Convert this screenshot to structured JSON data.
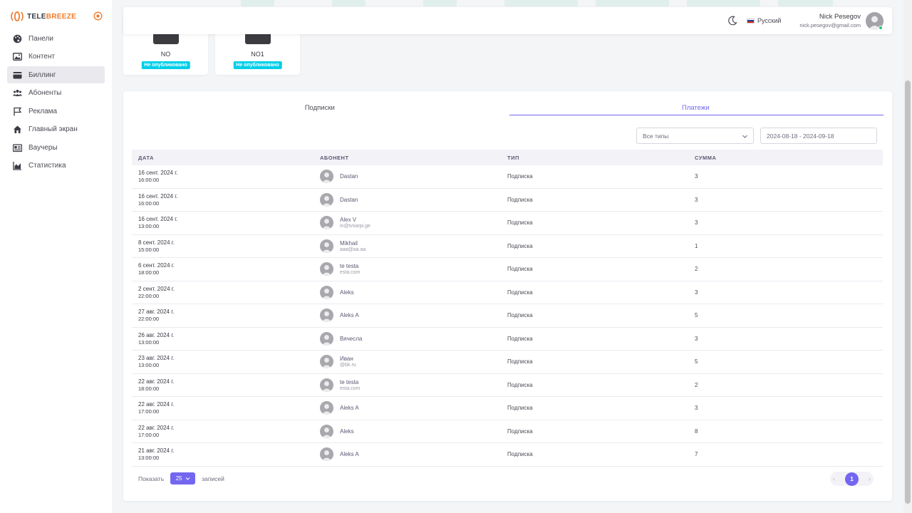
{
  "app": {
    "logo_part1": "TELE",
    "logo_part2": "BREEZE"
  },
  "sidebar": {
    "items": [
      {
        "label": "Панели",
        "icon": "palette-icon"
      },
      {
        "label": "Контент",
        "icon": "image-icon"
      },
      {
        "label": "Биллинг",
        "icon": "wallet-icon"
      },
      {
        "label": "Абоненты",
        "icon": "users-icon"
      },
      {
        "label": "Реклама",
        "icon": "flag-icon"
      },
      {
        "label": "Главный экран",
        "icon": "home-icon"
      },
      {
        "label": "Ваучеры",
        "icon": "voucher-icon"
      },
      {
        "label": "Статистика",
        "icon": "chart-icon"
      }
    ],
    "active_index": 2
  },
  "header": {
    "language": "Русский",
    "user_name": "Nick Pesegov",
    "user_email": "nick.pesegov@gmail.com"
  },
  "cards": [
    {
      "name": "NO",
      "status": "Не опубликовано"
    },
    {
      "name": "NO1",
      "status": "Не опубликовано"
    }
  ],
  "tabs": [
    {
      "label": "Подписки",
      "active": false
    },
    {
      "label": "Платежи",
      "active": true
    }
  ],
  "filters": {
    "type_value": "Все типы",
    "date_range": "2024-08-18 - 2024-09-18"
  },
  "table": {
    "headers": [
      "ДАТА",
      "АБОНЕНТ",
      "ТИП",
      "СУММА"
    ],
    "rows": [
      {
        "date": "16 сент. 2024 г.",
        "time": "16:00:00",
        "name": "Dastan",
        "email": "",
        "type": "Подписка",
        "amount": "3"
      },
      {
        "date": "16 сент. 2024 г.",
        "time": "16:00:00",
        "name": "Dastan",
        "email": "",
        "type": "Подписка",
        "amount": "3"
      },
      {
        "date": "16 сент. 2024 г.",
        "time": "13:00:00",
        "name": "Alex V",
        "email": "in@tvsarpi.ge",
        "type": "Подписка",
        "amount": "3"
      },
      {
        "date": "8 сент. 2024 г.",
        "time": "15:00:00",
        "name": "Mikhail",
        "email": "aaa@aa.aa",
        "type": "Подписка",
        "amount": "1"
      },
      {
        "date": "6 сент. 2024 г.",
        "time": "18:00:00",
        "name": "te testa",
        "email": "esta.com",
        "type": "Подписка",
        "amount": "2"
      },
      {
        "date": "2 сент. 2024 г.",
        "time": "22:00:00",
        "name": "Aleks",
        "email": "",
        "type": "Подписка",
        "amount": "3"
      },
      {
        "date": "27 авг. 2024 г.",
        "time": "22:00:00",
        "name": "Aleks A",
        "email": "",
        "type": "Подписка",
        "amount": "5"
      },
      {
        "date": "26 авг. 2024 г.",
        "time": "13:00:00",
        "name": "Вячесла",
        "email": "",
        "type": "Подписка",
        "amount": "3"
      },
      {
        "date": "23 авг. 2024 г.",
        "time": "13:00:00",
        "name": "Иван",
        "email": "@bk.ru",
        "type": "Подписка",
        "amount": "5"
      },
      {
        "date": "22 авг. 2024 г.",
        "time": "18:00:00",
        "name": "te testa",
        "email": "esta.com",
        "type": "Подписка",
        "amount": "2"
      },
      {
        "date": "22 авг. 2024 г.",
        "time": "17:00:00",
        "name": "Aleks A",
        "email": "",
        "type": "Подписка",
        "amount": "3"
      },
      {
        "date": "22 авг. 2024 г.",
        "time": "17:00:00",
        "name": "Aleks",
        "email": "",
        "type": "Подписка",
        "amount": "8"
      },
      {
        "date": "21 авг. 2024 г.",
        "time": "13:00:00",
        "name": "Aleks A",
        "email": "",
        "type": "Подписка",
        "amount": "7"
      }
    ]
  },
  "footer": {
    "show_label": "Показать",
    "per_page": "25",
    "records_label": "записей",
    "current_page": "1",
    "prev_glyph": "‹",
    "next_glyph": "›"
  },
  "colors": {
    "accent": "#7367f0",
    "badge": "#00cfe8",
    "logo_orange": "#f07b2b",
    "online": "#28c76f"
  }
}
